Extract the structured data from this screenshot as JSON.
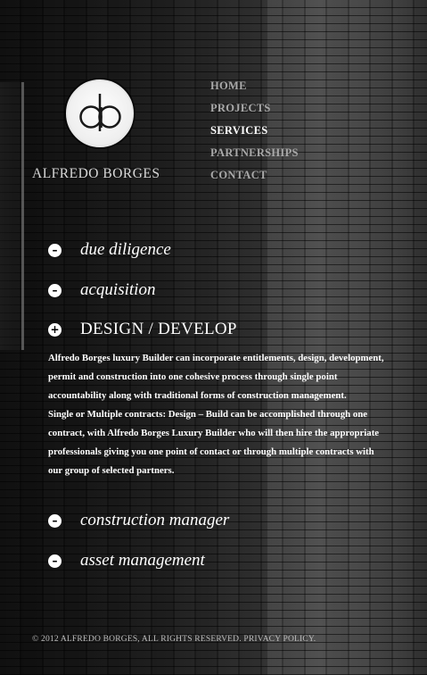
{
  "brand": {
    "logo_text": "ab",
    "name": "ALFREDO BORGES"
  },
  "nav": {
    "items": [
      {
        "label": "HOME",
        "active": false
      },
      {
        "label": "PROJECTS",
        "active": false
      },
      {
        "label": "SERVICES",
        "active": true
      },
      {
        "label": "PARTNERSHIPS",
        "active": false
      },
      {
        "label": "CONTACT",
        "active": false
      }
    ]
  },
  "services": {
    "sections": [
      {
        "title": "due diligence",
        "icon": "minus-icon",
        "expanded": false
      },
      {
        "title": "acquisition",
        "icon": "minus-icon",
        "expanded": false
      },
      {
        "title": "DESIGN / DEVELOP",
        "icon": "plus-icon",
        "expanded": true
      },
      {
        "title": "construction manager",
        "icon": "minus-icon",
        "expanded": false
      },
      {
        "title": "asset management",
        "icon": "minus-icon",
        "expanded": false
      }
    ],
    "design_develop_body": [
      "Alfredo Borges luxury Builder can incorporate entitlements, design, development, permit and construction into one cohesive process through single point accountability along with traditional forms of construction management.",
      "Single or Multiple contracts: Design – Build can be accomplished through one contract, with Alfredo Borges Luxury Builder who will then hire the appropriate professionals giving you one point of contact or through multiple contracts with our group of selected partners."
    ]
  },
  "footer": {
    "copyright": "© 2012 ALFREDO BORGES, ALL RIGHTS RESERVED.",
    "privacy_link": "PRIVACY POLICY."
  },
  "colors": {
    "active_nav": "#ffffff",
    "inactive_nav": "#a9a9a9",
    "background": "#161616"
  }
}
